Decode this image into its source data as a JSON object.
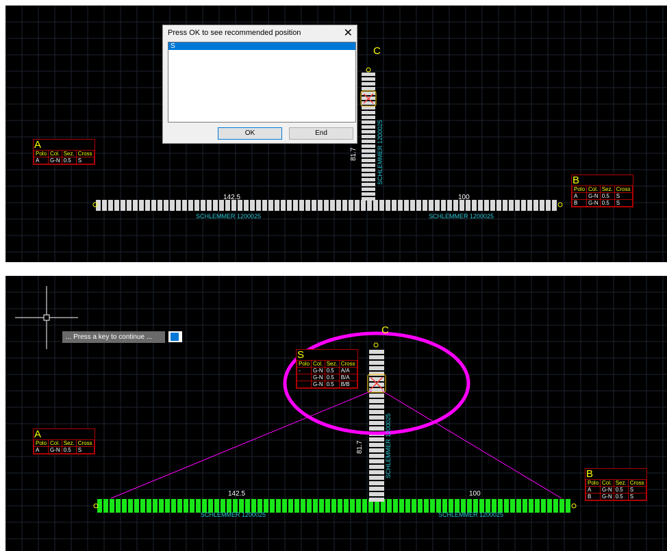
{
  "top_panel": {
    "dialog": {
      "title": "Press OK to see recommended position",
      "close_glyph": "✕",
      "list_items": [
        "S"
      ],
      "ok_label": "OK",
      "end_label": "End"
    },
    "node_c_label": "C",
    "tag_a": {
      "letter": "A",
      "headers": [
        "Polo",
        "Col.",
        "Sez.",
        "Cross"
      ],
      "rows": [
        [
          "A",
          "G-N",
          "0.5",
          "S"
        ]
      ]
    },
    "tag_b": {
      "letter": "B",
      "headers": [
        "Polo",
        "Col.",
        "Sez.",
        "Cross"
      ],
      "rows": [
        [
          "A",
          "G-N",
          "0.5",
          "S"
        ],
        [
          "B",
          "G-N",
          "0.5",
          "S"
        ]
      ]
    },
    "dim_left": "142.5",
    "dim_right": "100",
    "dim_vertical": "81.7",
    "cable_left": "SCHLEMMER 1200025",
    "cable_right": "SCHLEMMER 1200025",
    "cable_vertical": "SCHLEMMER 1200025"
  },
  "bottom_panel": {
    "prompt_text": "... Press a key to continue ...",
    "node_c_label": "C",
    "tag_s": {
      "letter": "S",
      "headers": [
        "Polo",
        "Col.",
        "Sez.",
        "Cross"
      ],
      "rows": [
        [
          "-",
          "G-N",
          "0.5",
          "A/A"
        ],
        [
          "",
          "G-N",
          "0.5",
          "B/A"
        ],
        [
          "",
          "G-N",
          "0.5",
          "B/B"
        ]
      ]
    },
    "tag_a": {
      "letter": "A",
      "headers": [
        "Polo",
        "Col.",
        "Sez.",
        "Cross"
      ],
      "rows": [
        [
          "A",
          "G-N",
          "0.5",
          "S"
        ]
      ]
    },
    "tag_b": {
      "letter": "B",
      "headers": [
        "Polo",
        "Col.",
        "Sez.",
        "Cross"
      ],
      "rows": [
        [
          "A",
          "G-N",
          "0.5",
          "S"
        ],
        [
          "B",
          "G-N",
          "0.5",
          "S"
        ]
      ]
    },
    "dim_left": "142.5",
    "dim_right": "100",
    "dim_vertical": "81.7",
    "cable_left": "SCHLEMMER 1200025",
    "cable_right": "SCHLEMMER 1200025",
    "cable_vertical": "SCHLEMMER 1200025"
  },
  "colors": {
    "background": "#000000",
    "grid": "#1c2530",
    "segment_gray": "#d9d9d9",
    "segment_green": "#19e619",
    "cable_text": "#29c7d6",
    "tag_border": "#b00000",
    "node_yellow": "#ffff00",
    "highlight_magenta": "#ff00ff",
    "dialog_selection": "#0078d7"
  }
}
